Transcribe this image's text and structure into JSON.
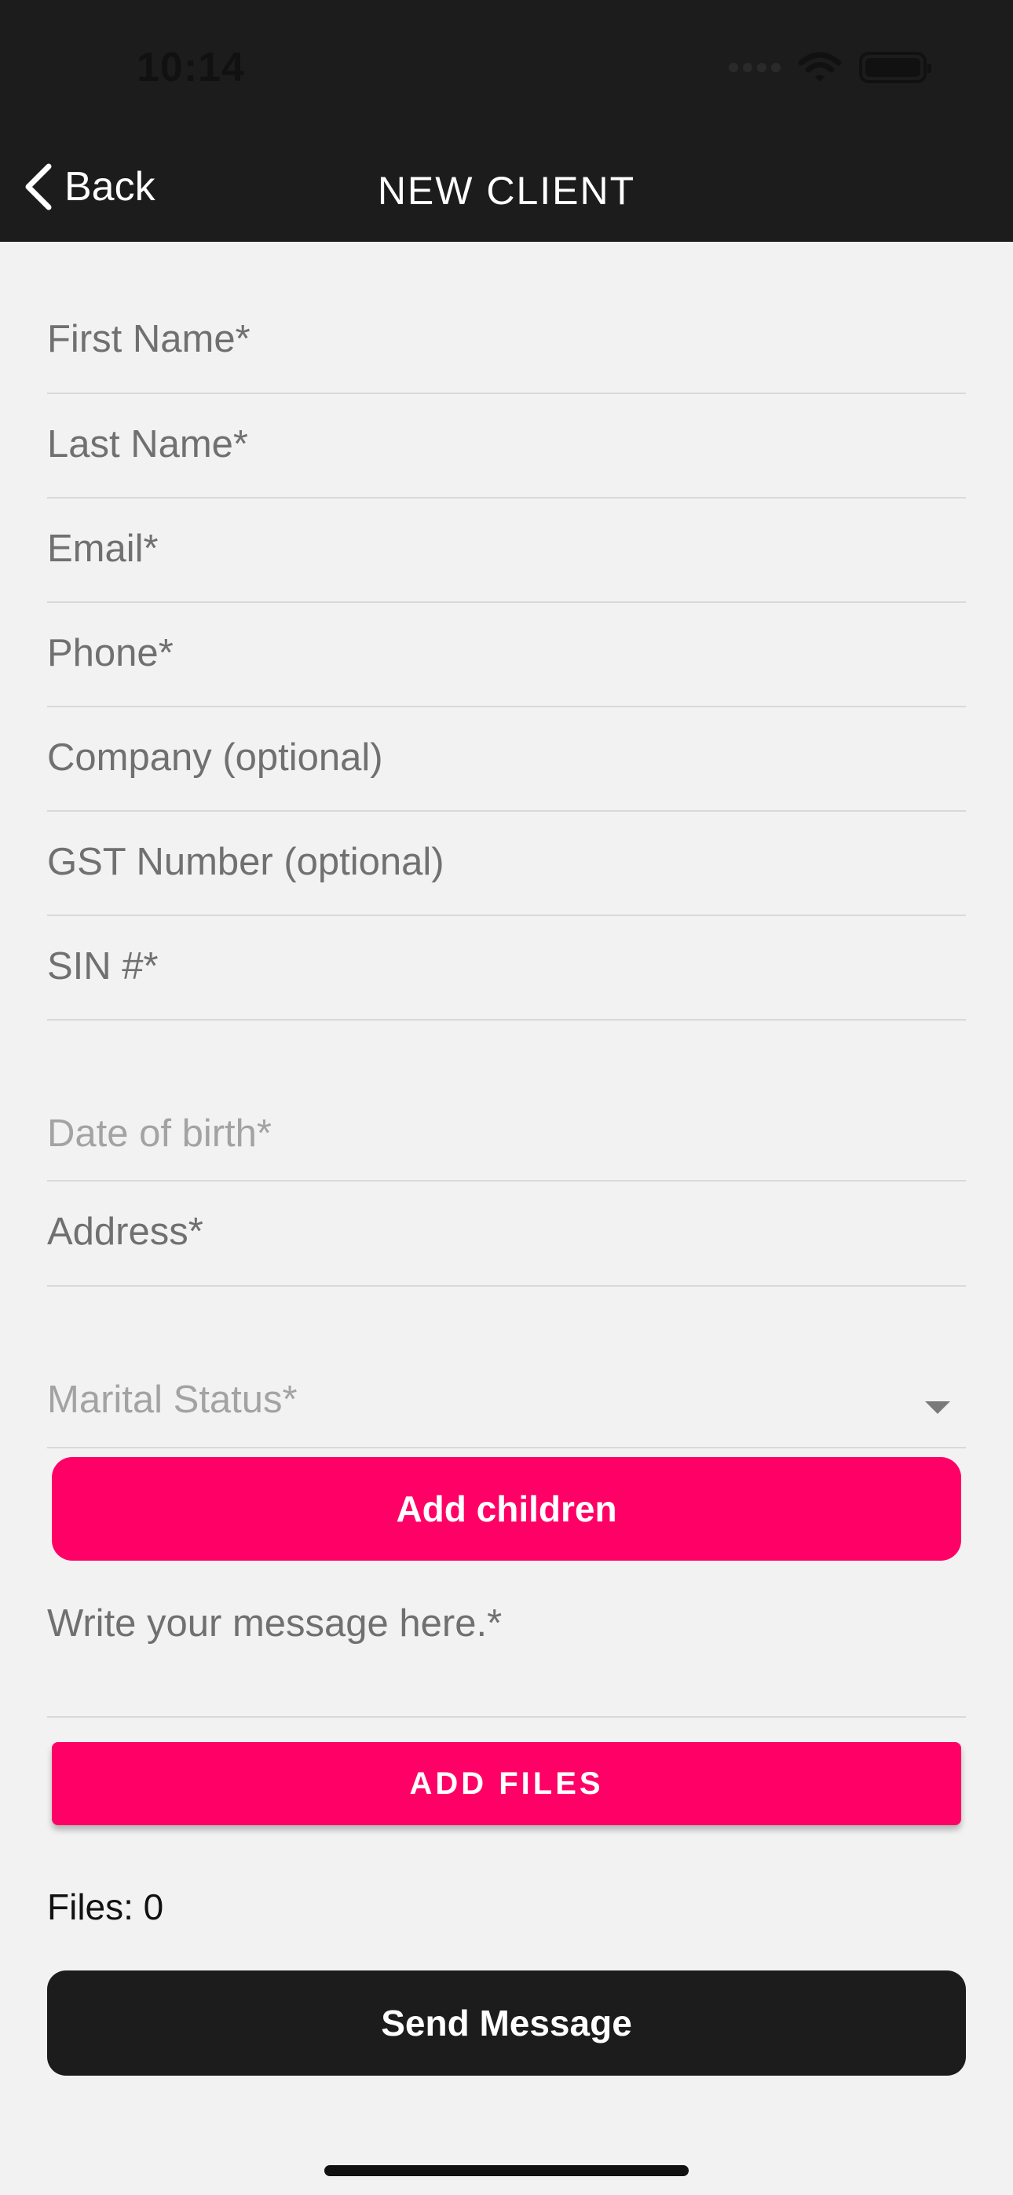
{
  "status_bar": {
    "time": "10:14"
  },
  "nav": {
    "back_label": "Back",
    "title": "NEW CLIENT"
  },
  "form": {
    "first_name": "First Name*",
    "last_name": "Last Name*",
    "email": "Email*",
    "phone": "Phone*",
    "company": "Company (optional)",
    "gst": "GST Number (optional)",
    "sin": "SIN #*",
    "dob": "Date of birth*",
    "address": "Address*",
    "marital_status": "Marital Status*",
    "message": "Write your message here.*"
  },
  "buttons": {
    "add_children": "Add children",
    "add_files": "ADD FILES",
    "send_message": "Send Message"
  },
  "files": {
    "label": "Files: 0"
  },
  "colors": {
    "accent": "#ff0066",
    "header": "#1c1c1c",
    "background": "#f2f2f2"
  },
  "icons": {
    "back": "chevron-left-icon",
    "wifi": "wifi-icon",
    "battery": "battery-icon",
    "signal": "cellular-signal-icon",
    "dropdown": "caret-down-icon"
  }
}
